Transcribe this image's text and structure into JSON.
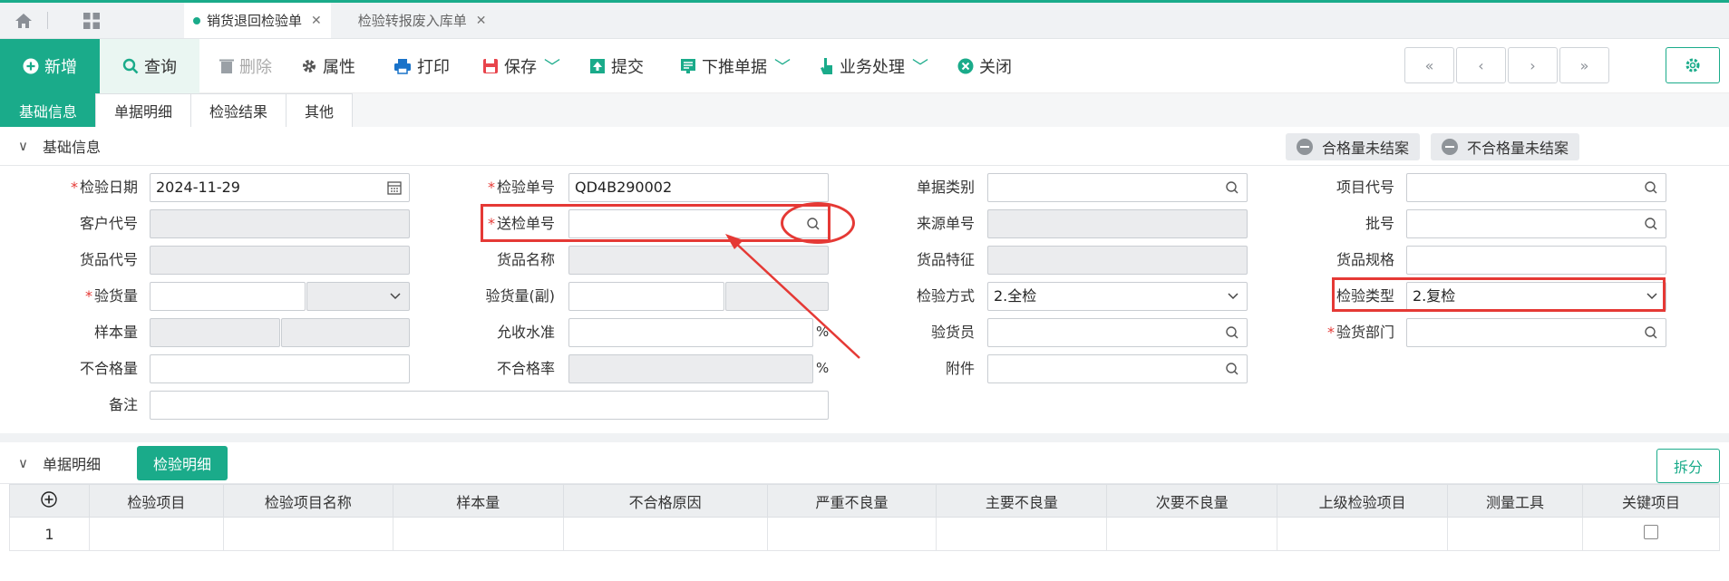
{
  "tabs": [
    {
      "label": "销货退回检验单",
      "active": true
    },
    {
      "label": "检验转报废入库单",
      "active": false
    }
  ],
  "toolbar": {
    "new": "新增",
    "query": "查询",
    "delete": "删除",
    "properties": "属性",
    "print": "打印",
    "save": "保存",
    "submit": "提交",
    "push_down": "下推单据",
    "business": "业务处理",
    "close": "关闭"
  },
  "subtabs": [
    "基础信息",
    "单据明细",
    "检验结果",
    "其他"
  ],
  "basic_section": {
    "title": "基础信息",
    "qualified_btn": "合格量未结案",
    "unqualified_btn": "不合格量未结案"
  },
  "form": {
    "inspect_date": {
      "label": "检验日期",
      "value": "2024-11-29"
    },
    "inspect_no": {
      "label": "检验单号",
      "value": "QD4B290002"
    },
    "doc_type": {
      "label": "单据类别",
      "value": ""
    },
    "project_code": {
      "label": "项目代号",
      "value": ""
    },
    "customer_code": {
      "label": "客户代号",
      "value": ""
    },
    "send_no": {
      "label": "送检单号",
      "value": ""
    },
    "source_no": {
      "label": "来源单号",
      "value": ""
    },
    "batch_no": {
      "label": "批号",
      "value": ""
    },
    "goods_code": {
      "label": "货品代号",
      "value": ""
    },
    "goods_name": {
      "label": "货品名称",
      "value": ""
    },
    "goods_feature": {
      "label": "货品特征",
      "value": ""
    },
    "goods_spec": {
      "label": "货品规格",
      "value": ""
    },
    "inspect_qty": {
      "label": "验货量",
      "value": ""
    },
    "inspect_qty2": {
      "label": "验货量(副)",
      "value": ""
    },
    "inspect_method": {
      "label": "检验方式",
      "value": "2.全检"
    },
    "inspect_type": {
      "label": "检验类型",
      "value": "2.复检"
    },
    "sample_qty": {
      "label": "样本量",
      "value": ""
    },
    "accept_level": {
      "label": "允收水准",
      "value": ""
    },
    "inspector": {
      "label": "验货员",
      "value": ""
    },
    "inspect_dept": {
      "label": "验货部门",
      "value": ""
    },
    "unqualified_qty": {
      "label": "不合格量",
      "value": ""
    },
    "unqualified_rate": {
      "label": "不合格率",
      "value": ""
    },
    "attachment": {
      "label": "附件",
      "value": ""
    },
    "remark": {
      "label": "备注",
      "value": ""
    },
    "percent": "%"
  },
  "detail_section": {
    "title": "单据明细",
    "tab": "检验明细",
    "split_btn": "拆分"
  },
  "table": {
    "columns": [
      "检验项目",
      "检验项目名称",
      "样本量",
      "不合格原因",
      "严重不良量",
      "主要不良量",
      "次要不良量",
      "上级检验项目",
      "测量工具",
      "关键项目"
    ],
    "rows": [
      {
        "no": "1"
      }
    ]
  }
}
